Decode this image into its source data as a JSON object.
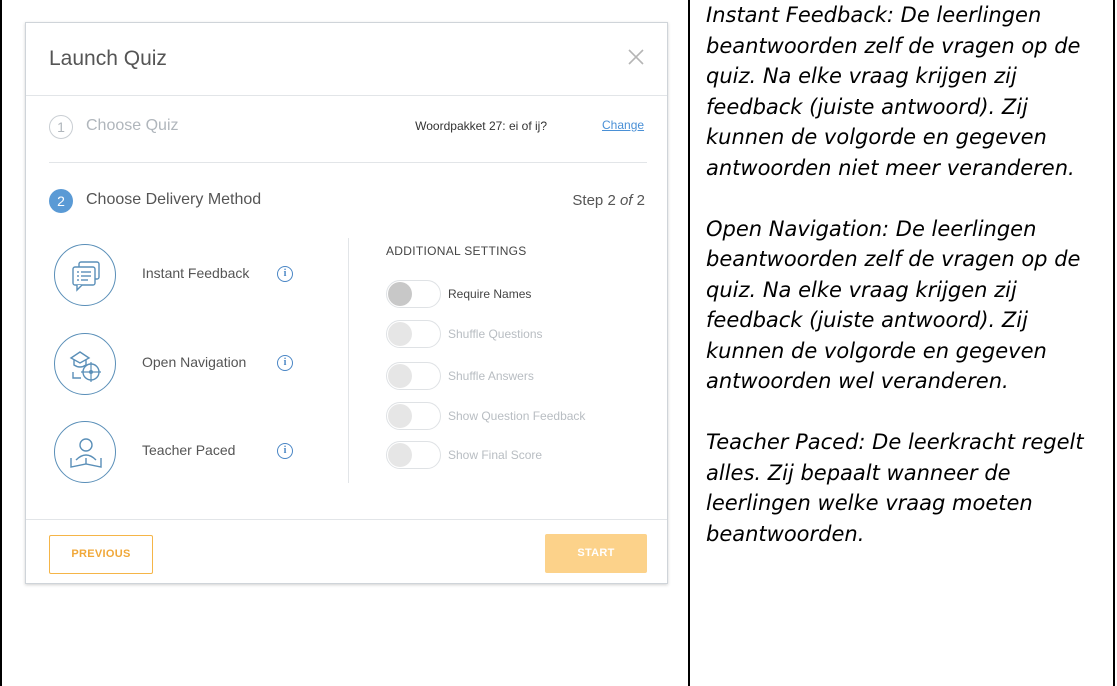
{
  "modal": {
    "title": "Launch Quiz",
    "close_icon": "close-icon"
  },
  "steps": [
    {
      "number": "1",
      "label": "Choose Quiz",
      "state": "done"
    },
    {
      "number": "2",
      "label": "Choose Delivery Method",
      "state": "active"
    }
  ],
  "quiz": {
    "name": "Woordpakket 27: ei of ij?",
    "change_label": "Change"
  },
  "step_counter": {
    "prefix": "Step 2 ",
    "of": "of",
    "suffix": " 2"
  },
  "methods": [
    {
      "label": "Instant Feedback",
      "icon": "instant-feedback-icon"
    },
    {
      "label": "Open Navigation",
      "icon": "open-navigation-icon"
    },
    {
      "label": "Teacher Paced",
      "icon": "teacher-paced-icon"
    }
  ],
  "additional_settings": {
    "heading": "ADDITIONAL SETTINGS",
    "items": [
      {
        "label": "Require Names",
        "enabled": true,
        "on": false
      },
      {
        "label": "Shuffle Questions",
        "enabled": false,
        "on": false
      },
      {
        "label": "Shuffle Answers",
        "enabled": false,
        "on": false
      },
      {
        "label": "Show Question Feedback",
        "enabled": false,
        "on": false
      },
      {
        "label": "Show Final Score",
        "enabled": false,
        "on": false
      }
    ]
  },
  "buttons": {
    "previous": "PREVIOUS",
    "start": "START"
  },
  "colors": {
    "accent_blue": "#5a9ad5",
    "accent_orange": "#f5b548",
    "start_disabled": "#fcd28a"
  },
  "description": {
    "paragraphs": [
      "Instant Feedback: De leerlingen beantwoorden zelf de vragen op de quiz. Na elke vraag krijgen zij feedback (juiste antwoord). Zij kunnen de volgorde en gegeven antwoorden niet meer veranderen.",
      "Open Navigation: De leerlingen beantwoorden zelf de vragen op de quiz. Na elke vraag krijgen zij feedback (juiste antwoord). Zij kunnen de volgorde en gegeven antwoorden wel veranderen.",
      "Teacher Paced: De leerkracht regelt alles. Zij bepaalt wanneer de leerlingen welke vraag moeten beantwoorden."
    ]
  }
}
